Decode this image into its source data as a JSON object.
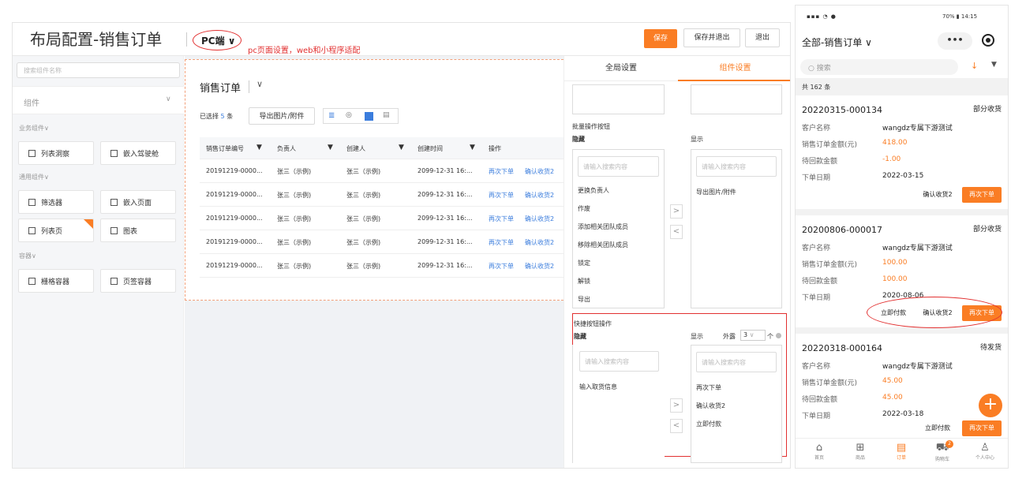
{
  "header": {
    "title": "布局配置-销售订单",
    "platform": "PC端 ∨",
    "note": "pc页面设置，web和小程序适配",
    "save": "保存",
    "save_exit": "保存并退出",
    "exit": "退出"
  },
  "left": {
    "search_placeholder": "搜索组件名称",
    "dropdown": "组件",
    "groups": [
      {
        "label": "业务组件∨",
        "items": [
          "列表洞察",
          "嵌入驾驶舱"
        ]
      },
      {
        "label": "通用组件∨",
        "items": [
          "筛选器",
          "嵌入页面",
          "列表页",
          "图表"
        ]
      },
      {
        "label": "容器∨",
        "items": [
          "栅格容器",
          "页签容器"
        ]
      }
    ]
  },
  "canvas": {
    "title": "销售订单",
    "selected_prefix": "已选择",
    "selected_count": "5",
    "selected_suffix": "条",
    "export_btn": "导出图片/附件",
    "columns": [
      "销售订单编号",
      "负责人",
      "创建人",
      "创建时间",
      "操作"
    ],
    "rows": [
      [
        "20191219-0000...",
        "张三（示例)",
        "张三（示例)",
        "2099-12-31 16:...",
        "再次下单",
        "确认收货2"
      ],
      [
        "20191219-0000...",
        "张三（示例)",
        "张三（示例)",
        "2099-12-31 16:...",
        "再次下单",
        "确认收货2"
      ],
      [
        "20191219-0000...",
        "张三（示例)",
        "张三（示例)",
        "2099-12-31 16:...",
        "再次下单",
        "确认收货2"
      ],
      [
        "20191219-0000...",
        "张三（示例)",
        "张三（示例)",
        "2099-12-31 16:...",
        "再次下单",
        "确认收货2"
      ],
      [
        "20191219-0000...",
        "张三（示例)",
        "张三（示例)",
        "2099-12-31 16:...",
        "再次下单",
        "确认收货2"
      ]
    ]
  },
  "right": {
    "tab_global": "全局设置",
    "tab_component": "组件设置",
    "batch_title": "批量操作按钮",
    "hidden": "隐藏",
    "show": "显示",
    "search_placeholder": "请输入搜索内容",
    "batch_hidden_items": [
      "更换负责人",
      "作废",
      "添加相关团队成员",
      "移除相关团队成员",
      "锁定",
      "解锁",
      "导出"
    ],
    "batch_show_items": [
      "导出图片/附件"
    ],
    "quick_title": "快捷按钮操作",
    "outside": "外露",
    "outside_count": "3",
    "outside_unit": "个",
    "quick_hidden_items": [
      "输入取货信息"
    ],
    "quick_show_items": [
      "再次下单",
      "确认收货2",
      "立即付款"
    ]
  },
  "phone": {
    "status_time": "14:15",
    "status_battery": "70%",
    "title": "全部-销售订单 ∨",
    "search": "搜索",
    "total": "共 162 条",
    "labels": {
      "customer": "客户名称",
      "amount": "销售订单金额(元)",
      "receivable": "待回款金额",
      "date": "下单日期"
    },
    "orders": [
      {
        "no": "20220315-000134",
        "status": "部分收货",
        "customer": "wangdz专属下游测试",
        "amount": "418.00",
        "receivable": "-1.00",
        "date": "2022-03-15",
        "buttons": [
          "确认收货2",
          "再次下单"
        ]
      },
      {
        "no": "20200806-000017",
        "status": "部分收货",
        "customer": "wangdz专属下游测试",
        "amount": "100.00",
        "receivable": "100.00",
        "date": "2020-08-06",
        "buttons": [
          "立即付款",
          "确认收货2",
          "再次下单"
        ]
      },
      {
        "no": "20220318-000164",
        "status": "待发货",
        "customer": "wangdz专属下游测试",
        "amount": "45.00",
        "receivable": "45.00",
        "date": "2022-03-18",
        "buttons": [
          "立即付款",
          "再次下单"
        ]
      }
    ],
    "nav": [
      "首页",
      "商品",
      "订单",
      "购物车",
      "个人中心"
    ],
    "cart_badge": "2"
  },
  "colors": {
    "accent": "#fa7d24",
    "link": "#3b7ddd",
    "annotation": "#e23030"
  }
}
